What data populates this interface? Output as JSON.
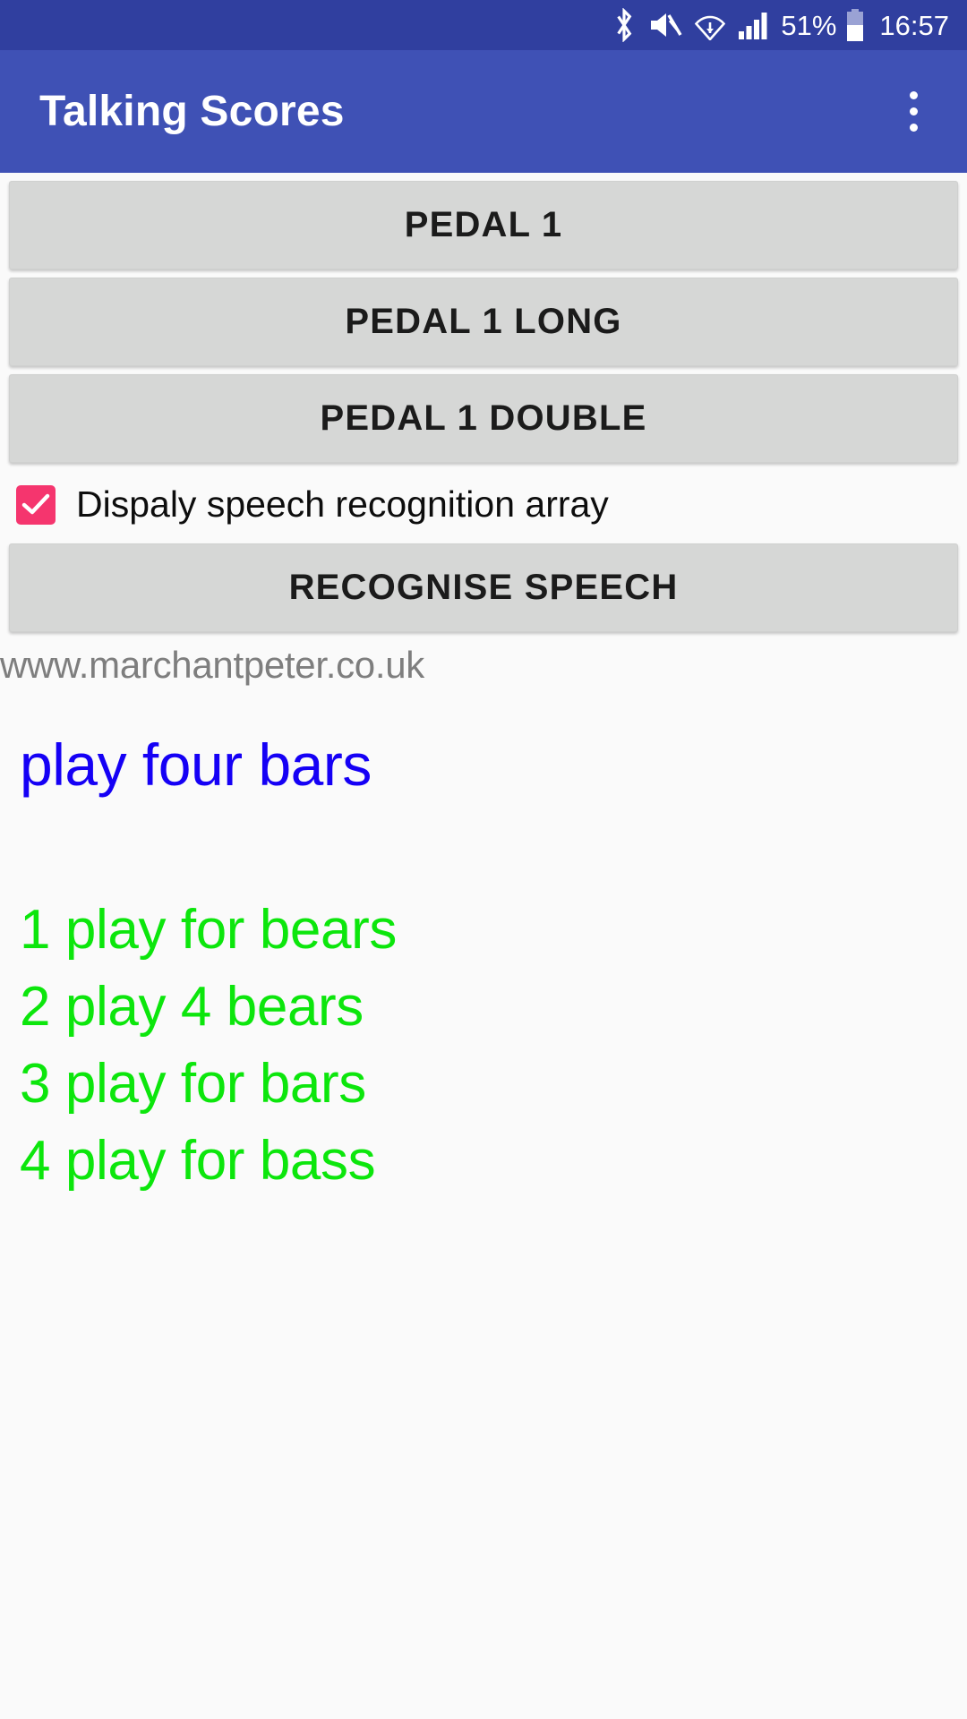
{
  "status_bar": {
    "bluetooth_icon": "bluetooth-icon",
    "mute_icon": "volume-mute-icon",
    "wifi_icon": "wifi-icon",
    "signal_icon": "cellular-signal-icon",
    "battery_percent": "51%",
    "battery_icon": "battery-icon",
    "clock": "16:57",
    "background_color": "#303f9f"
  },
  "app_bar": {
    "title": "Talking Scores",
    "overflow_menu_icon": "overflow-menu-icon",
    "background_color": "#3f51b5"
  },
  "buttons": [
    {
      "label": "PEDAL 1"
    },
    {
      "label": "PEDAL 1 LONG"
    },
    {
      "label": "PEDAL 1 DOUBLE"
    }
  ],
  "checkbox": {
    "label": "Dispaly speech recognition array",
    "checked": true,
    "accent_color": "#f5356e",
    "check_icon": "checkmark-icon"
  },
  "recognise_button": {
    "label": "RECOGNISE SPEECH"
  },
  "site_url": {
    "text": "www.marchantpeter.co.uk",
    "color": "#7e7e7e"
  },
  "speech_result": {
    "recognised_phrase": "play four bars",
    "phrase_color": "#1500f5",
    "alternatives_color": "#0ce60c",
    "alternatives": [
      "1 play for bears",
      "2 play 4 bears",
      "3 play for bars",
      "4 play for bass"
    ]
  }
}
